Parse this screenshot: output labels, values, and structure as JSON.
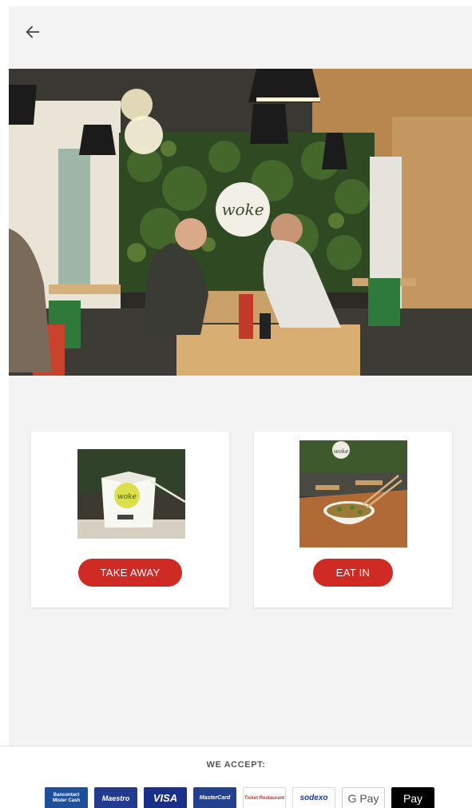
{
  "header": {
    "back_icon": "arrow-left-icon"
  },
  "hero": {
    "sign_text": "woke"
  },
  "options": [
    {
      "label": "TAKE AWAY",
      "thumb_text": "woke"
    },
    {
      "label": "EAT IN",
      "thumb_text": "woke"
    }
  ],
  "footer": {
    "accept_label": "WE ACCEPT:",
    "payments": [
      {
        "name": "bancontact",
        "line1": "Bancontact",
        "line2": "Mister Cash"
      },
      {
        "name": "maestro",
        "label": "Maestro"
      },
      {
        "name": "visa",
        "label": "VISA"
      },
      {
        "name": "mastercard",
        "label": "MasterCard"
      },
      {
        "name": "ticket-restaurant",
        "label": "Ticket Restaurant"
      },
      {
        "name": "sodexo",
        "label": "sodexo"
      },
      {
        "name": "google-pay",
        "label": "G Pay"
      },
      {
        "name": "apple-pay",
        "label": " Pay"
      }
    ]
  },
  "colors": {
    "accent": "#cf2a24",
    "background": "#f3f3f3"
  }
}
